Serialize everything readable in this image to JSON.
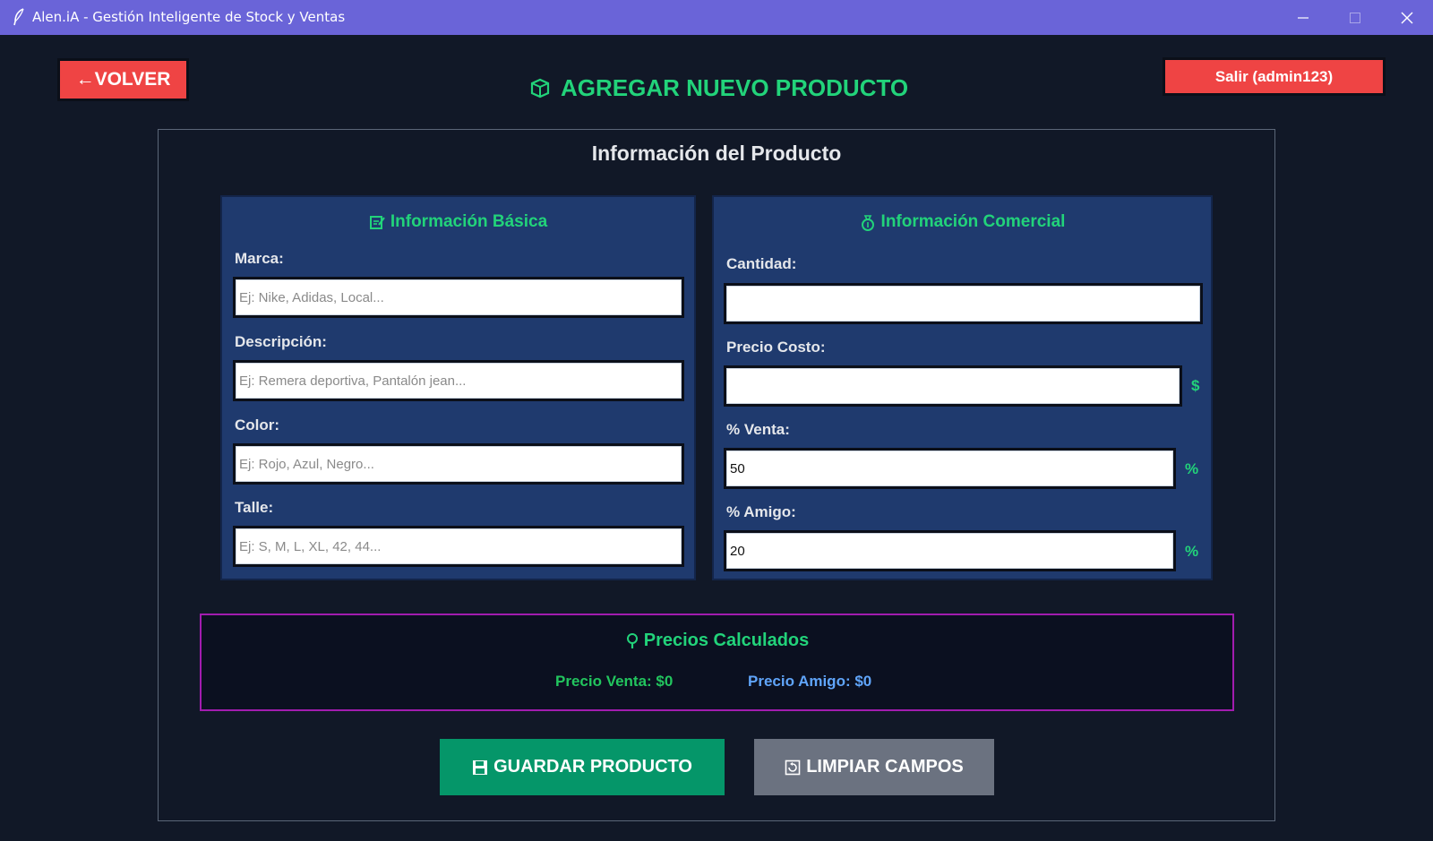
{
  "window": {
    "title": "Alen.iA - Gestión Inteligente de Stock y Ventas",
    "controls": [
      "minimize-icon",
      "maximize-icon",
      "close-icon"
    ]
  },
  "header": {
    "back_label": "←VOLVER",
    "title": "AGREGAR NUEVO PRODUCTO",
    "title_icon": "package-icon",
    "exit_label": "Salir (admin123)"
  },
  "panel": {
    "heading": "Información del Producto"
  },
  "basic": {
    "heading": "Información Básica",
    "icon": "memo-icon",
    "fields": [
      {
        "label": "Marca:",
        "value": "",
        "placeholder": "Ej: Nike, Adidas, Local..."
      },
      {
        "label": "Descripción:",
        "value": "",
        "placeholder": "Ej: Remera deportiva, Pantalón jean..."
      },
      {
        "label": "Color:",
        "value": "",
        "placeholder": "Ej: Rojo, Azul, Negro..."
      },
      {
        "label": "Talle:",
        "value": "",
        "placeholder": "Ej: S, M, L, XL, 42, 44..."
      }
    ]
  },
  "commercial": {
    "heading": "Información Comercial",
    "icon": "money-bag-icon",
    "fields": [
      {
        "label": "Cantidad:",
        "value": "",
        "unit": ""
      },
      {
        "label": "Precio Costo:",
        "value": "",
        "unit": "$"
      },
      {
        "label": "% Venta:",
        "value": "50",
        "unit": "%"
      },
      {
        "label": "% Amigo:",
        "value": "20",
        "unit": "%"
      }
    ]
  },
  "calculated": {
    "heading": "Precios Calculados",
    "icon": "lightbulb-icon",
    "sale_price": "Precio Venta: $0",
    "friend_price": "Precio Amigo: $0"
  },
  "actions": {
    "save_label": "GUARDAR PRODUCTO",
    "save_icon": "floppy-disk-icon",
    "clear_label": "LIMPIAR CAMPOS",
    "clear_icon": "clear-icon"
  },
  "colors": {
    "titlebar": "#6a64d8",
    "background": "#111827",
    "accent_green": "#22d37a",
    "danger": "#ef4444",
    "card": "#1f3a6e",
    "calc_border": "#a21caf",
    "save_button": "#059669",
    "clear_button": "#6b7280",
    "friend_price": "#60a5fa"
  }
}
